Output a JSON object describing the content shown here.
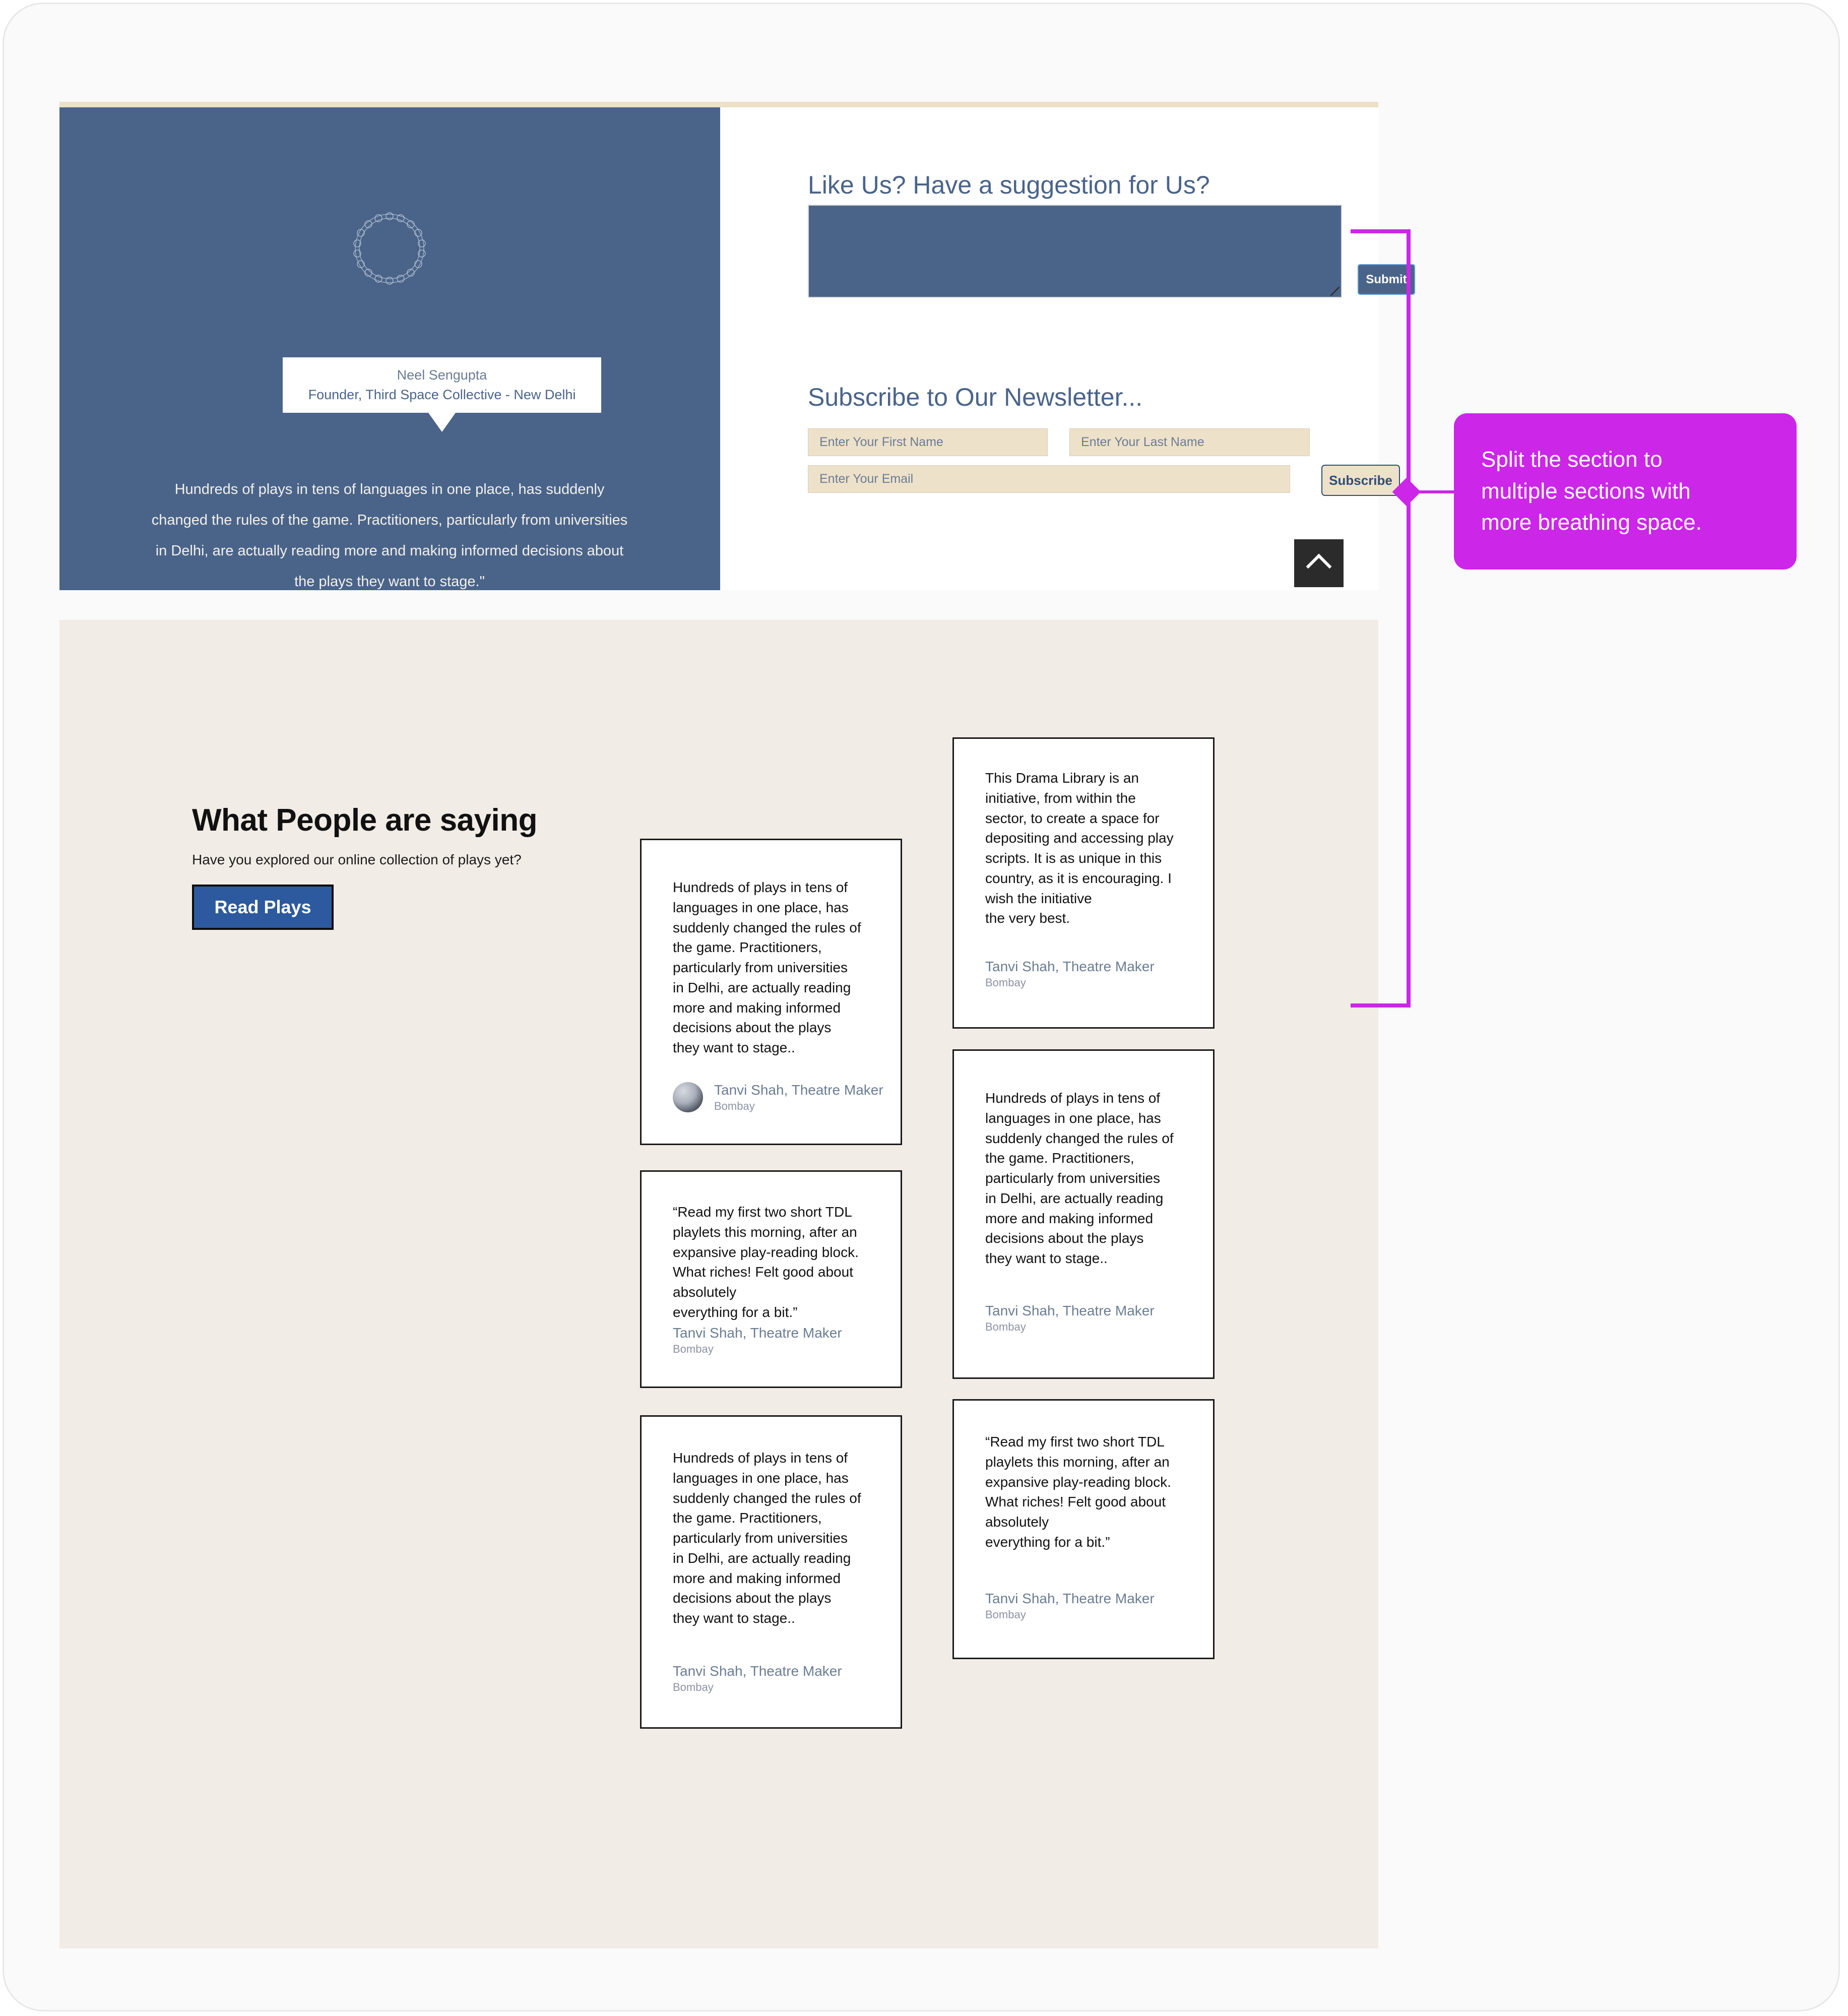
{
  "hero": {
    "speaker": {
      "name": "Neel Sengupta",
      "role": "Founder, Third Space Collective - New Delhi"
    },
    "quote": "Hundreds of plays in tens of languages in one place, has suddenly changed the rules of the game. Practitioners, particularly from universities in Delhi, are actually reading more and making informed decisions about the plays they want to stage.\"",
    "carousel": {
      "dot_count": 9
    },
    "suggestion": {
      "heading": "Like Us? Have a suggestion for Us?",
      "textarea_value": "",
      "submit_label": "Submit"
    },
    "newsletter": {
      "heading": "Subscribe to Our Newsletter...",
      "first_name_placeholder": "Enter Your First Name",
      "last_name_placeholder": "Enter Your Last Name",
      "email_placeholder": "Enter Your Email",
      "subscribe_label": "Subscribe"
    },
    "scroll_top_icon": "chevron-up-icon"
  },
  "testimonials": {
    "title": "What People are saying",
    "subtitle": "Have you explored our online collection of plays yet?",
    "cta_label": "Read Plays",
    "left_column": [
      {
        "quote": "Hundreds of plays in tens of\nlanguages in one place, has\nsuddenly changed the rules of\nthe game. Practitioners,\nparticularly from universities\nin Delhi, are actually reading\nmore and making informed\ndecisions about the plays\nthey want to stage..",
        "name": "Tanvi Shah, Theatre Maker",
        "city": "Bombay",
        "has_avatar": true
      },
      {
        "quote": "“Read my first two short TDL\nplaylets this morning, after an\nexpansive play-reading block.\nWhat riches! Felt good about\nabsolutely\neverything for a bit.”",
        "name": "Tanvi Shah, Theatre Maker",
        "city": "Bombay",
        "has_avatar": false
      },
      {
        "quote": "Hundreds of plays in tens of\nlanguages in one place, has\nsuddenly changed the rules of\nthe game. Practitioners,\nparticularly from universities\nin Delhi, are actually reading\nmore and making informed\ndecisions about the plays\nthey want to stage..",
        "name": "Tanvi Shah, Theatre Maker",
        "city": "Bombay",
        "has_avatar": false
      }
    ],
    "right_column": [
      {
        "quote": "This Drama Library is an\ninitiative, from within the\nsector, to create a space for\ndepositing and accessing play\nscripts. It is as unique in this\ncountry, as it is encouraging. I\nwish the initiative\nthe very best.",
        "name": "Tanvi Shah, Theatre Maker",
        "city": "Bombay",
        "has_avatar": false
      },
      {
        "quote": "Hundreds of plays in tens of\nlanguages in one place, has\nsuddenly changed the rules of\nthe game. Practitioners,\nparticularly from universities\nin Delhi, are actually reading\nmore and making informed\ndecisions about the plays\nthey want to stage..",
        "name": "Tanvi Shah, Theatre Maker",
        "city": "Bombay",
        "has_avatar": false
      },
      {
        "quote": "“Read my first two short TDL\nplaylets this morning, after an\nexpansive play-reading block.\nWhat riches! Felt good about\nabsolutely\neverything for a bit.”",
        "name": "Tanvi Shah, Theatre Maker",
        "city": "Bombay",
        "has_avatar": false
      }
    ]
  },
  "annotation": {
    "text": "Split the section to\nmultiple sections with\nmore breathing space.",
    "color": "#cc26e8"
  },
  "colors": {
    "hero_blue": "#4a6489",
    "cream": "#eee1c9",
    "section_beige": "#f1ece6",
    "cta_blue": "#2d5a9e",
    "annotation_magenta": "#cc26e8"
  }
}
